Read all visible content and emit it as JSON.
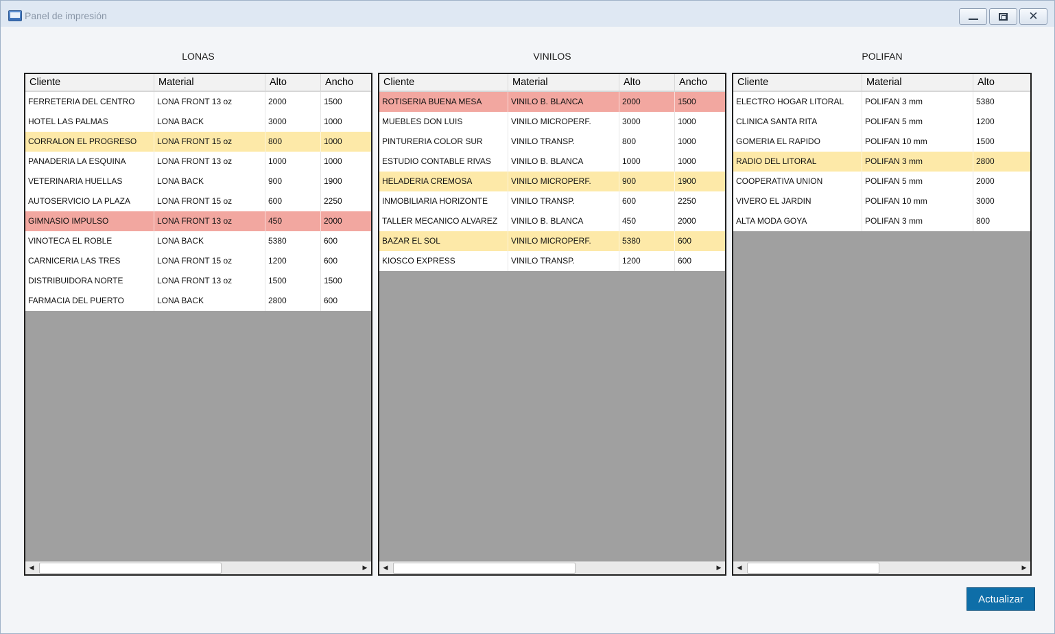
{
  "window": {
    "title": "Panel de impresión"
  },
  "lonas": {
    "title": "LONAS",
    "columns": [
      "Cliente",
      "Material",
      "Alto",
      "Ancho"
    ],
    "rows": [
      {
        "cliente": "FERRETERIA DEL CENTRO",
        "material": "LONA FRONT 13 oz",
        "alto": "2000",
        "ancho": "1500",
        "status": "normal"
      },
      {
        "cliente": "HOTEL LAS PALMAS",
        "material": "LONA BACK",
        "alto": "3000",
        "ancho": "1000",
        "status": "normal"
      },
      {
        "cliente": "CORRALON EL PROGRESO",
        "material": "LONA FRONT 15 oz",
        "alto": "800",
        "ancho": "1000",
        "status": "yellow"
      },
      {
        "cliente": "PANADERIA LA ESQUINA",
        "material": "LONA FRONT 13 oz",
        "alto": "1000",
        "ancho": "1000",
        "status": "normal"
      },
      {
        "cliente": "VETERINARIA HUELLAS",
        "material": "LONA BACK",
        "alto": "900",
        "ancho": "1900",
        "status": "normal"
      },
      {
        "cliente": "AUTOSERVICIO LA PLAZA",
        "material": "LONA FRONT 15 oz",
        "alto": "600",
        "ancho": "2250",
        "status": "normal"
      },
      {
        "cliente": "GIMNASIO IMPULSO",
        "material": "LONA FRONT 13 oz",
        "alto": "450",
        "ancho": "2000",
        "status": "red"
      },
      {
        "cliente": "VINOTECA EL ROBLE",
        "material": "LONA BACK",
        "alto": "5380",
        "ancho": "600",
        "status": "normal"
      },
      {
        "cliente": "CARNICERIA LAS TRES",
        "material": "LONA FRONT 15 oz",
        "alto": "1200",
        "ancho": "600",
        "status": "normal"
      },
      {
        "cliente": "DISTRIBUIDORA NORTE",
        "material": "LONA FRONT 13 oz",
        "alto": "1500",
        "ancho": "1500",
        "status": "normal"
      },
      {
        "cliente": "FARMACIA DEL PUERTO",
        "material": "LONA BACK",
        "alto": "2800",
        "ancho": "600",
        "status": "normal"
      }
    ]
  },
  "vinilos": {
    "title": "VINILOS",
    "columns": [
      "Cliente",
      "Material",
      "Alto",
      "Ancho"
    ],
    "rows": [
      {
        "cliente": "ROTISERIA BUENA MESA",
        "material": "VINILO B. BLANCA",
        "alto": "2000",
        "ancho": "1500",
        "status": "red"
      },
      {
        "cliente": "MUEBLES DON LUIS",
        "material": "VINILO MICROPERF.",
        "alto": "3000",
        "ancho": "1000",
        "status": "normal"
      },
      {
        "cliente": "PINTURERIA COLOR SUR",
        "material": "VINILO TRANSP.",
        "alto": "800",
        "ancho": "1000",
        "status": "normal"
      },
      {
        "cliente": "ESTUDIO CONTABLE RIVAS",
        "material": "VINILO B. BLANCA",
        "alto": "1000",
        "ancho": "1000",
        "status": "normal"
      },
      {
        "cliente": "HELADERIA CREMOSA",
        "material": "VINILO MICROPERF.",
        "alto": "900",
        "ancho": "1900",
        "status": "yellow"
      },
      {
        "cliente": "INMOBILIARIA HORIZONTE",
        "material": "VINILO TRANSP.",
        "alto": "600",
        "ancho": "2250",
        "status": "normal"
      },
      {
        "cliente": "TALLER MECANICO ALVAREZ",
        "material": "VINILO B. BLANCA",
        "alto": "450",
        "ancho": "2000",
        "status": "normal"
      },
      {
        "cliente": "BAZAR EL SOL",
        "material": "VINILO MICROPERF.",
        "alto": "5380",
        "ancho": "600",
        "status": "yellow"
      },
      {
        "cliente": "KIOSCO EXPRESS",
        "material": "VINILO TRANSP.",
        "alto": "1200",
        "ancho": "600",
        "status": "normal"
      }
    ]
  },
  "polifan": {
    "title": "POLIFAN",
    "columns": [
      "Cliente",
      "Material",
      "Alto"
    ],
    "rows": [
      {
        "cliente": "ELECTRO HOGAR LITORAL",
        "material": "POLIFAN 3 mm",
        "alto": "5380",
        "status": "normal"
      },
      {
        "cliente": "CLINICA SANTA RITA",
        "material": "POLIFAN 5 mm",
        "alto": "1200",
        "status": "normal"
      },
      {
        "cliente": "GOMERIA EL RAPIDO",
        "material": "POLIFAN 10 mm",
        "alto": "1500",
        "status": "normal"
      },
      {
        "cliente": "RADIO DEL LITORAL",
        "material": "POLIFAN 3 mm",
        "alto": "2800",
        "status": "yellow"
      },
      {
        "cliente": "COOPERATIVA UNION",
        "material": "POLIFAN 5 mm",
        "alto": "2000",
        "status": "normal"
      },
      {
        "cliente": "VIVERO EL JARDIN",
        "material": "POLIFAN 10 mm",
        "alto": "3000",
        "status": "normal"
      },
      {
        "cliente": "ALTA MODA GOYA",
        "material": "POLIFAN 3 mm",
        "alto": "800",
        "status": "normal"
      }
    ]
  },
  "actions": {
    "refresh_label": "Actualizar"
  },
  "colors": {
    "row_red": "#f2a7a0",
    "row_yellow": "#fde9a8",
    "accent_button": "#0e6ea8",
    "grid_empty": "#a0a0a0"
  }
}
